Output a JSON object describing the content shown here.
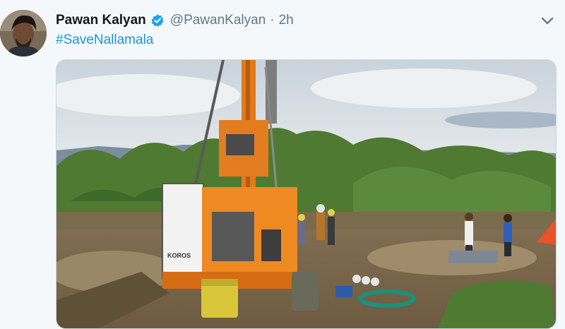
{
  "tweet": {
    "author_name": "Pawan Kalyan",
    "handle": "@PawanKalyan",
    "separator": "·",
    "time": "2h",
    "text": "#SaveNallamala"
  },
  "icons": {
    "verified": "verified-badge-icon",
    "more": "chevron-down-icon"
  },
  "colors": {
    "link": "#1b95e0",
    "verified": "#1da1f2",
    "name": "#14171a",
    "secondary": "#657786",
    "background": "#f5f8fa"
  },
  "media": {
    "type": "photo",
    "brand_on_machine": "KOROS"
  }
}
